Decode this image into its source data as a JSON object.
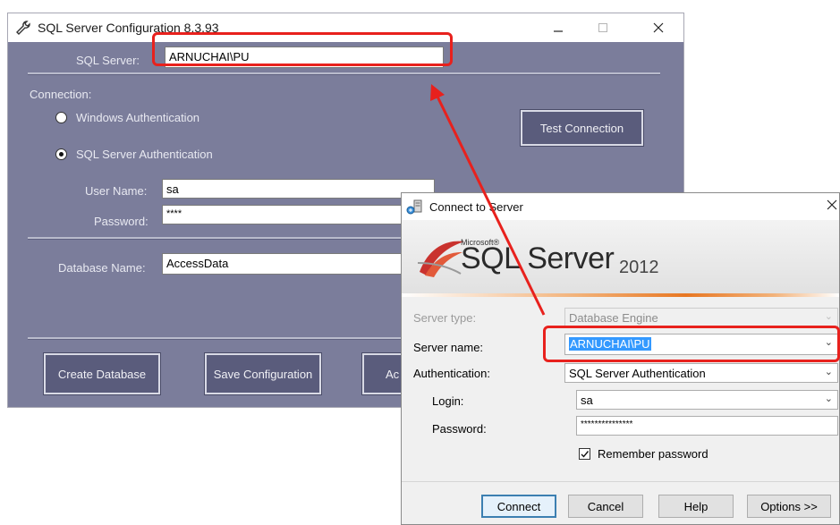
{
  "colors": {
    "accent_red": "#e8211d",
    "win1_bg": "#7b7d9b",
    "win2_bg": "#f0f0f0"
  },
  "config_window": {
    "title": "SQL Server Configuration 8.3.93",
    "icon": "wrench-icon",
    "sql_server_label": "SQL Server:",
    "sql_server_value": "ARNUCHAI\\PU",
    "connection_label": "Connection:",
    "windows_auth_label": "Windows Authentication",
    "sql_auth_label": "SQL Server Authentication",
    "selected_auth": "SQL Server Authentication",
    "user_name_label": "User Name:",
    "user_name_value": "sa",
    "password_label": "Password:",
    "password_value": "****",
    "database_name_label": "Database Name:",
    "database_name_value": "AccessData",
    "test_connection_label": "Test Connection",
    "create_database_label": "Create Database",
    "save_configuration_label": "Save Configuration",
    "partial_button_label": "Ac"
  },
  "connect_window": {
    "title": "Connect to Server",
    "icon": "server-connect-icon",
    "brand_microsoft": "Microsoft®",
    "brand_product": "SQL Server",
    "brand_version": "2012",
    "server_type_label": "Server type:",
    "server_type_value": "Database Engine",
    "server_name_label": "Server name:",
    "server_name_value": "ARNUCHAI\\PU",
    "authentication_label": "Authentication:",
    "authentication_value": "SQL Server Authentication",
    "login_label": "Login:",
    "login_value": "sa",
    "password_label": "Password:",
    "password_value": "***************",
    "remember_password_label": "Remember password",
    "remember_password_checked": true,
    "connect_label": "Connect",
    "cancel_label": "Cancel",
    "help_label": "Help",
    "options_label": "Options >>"
  }
}
